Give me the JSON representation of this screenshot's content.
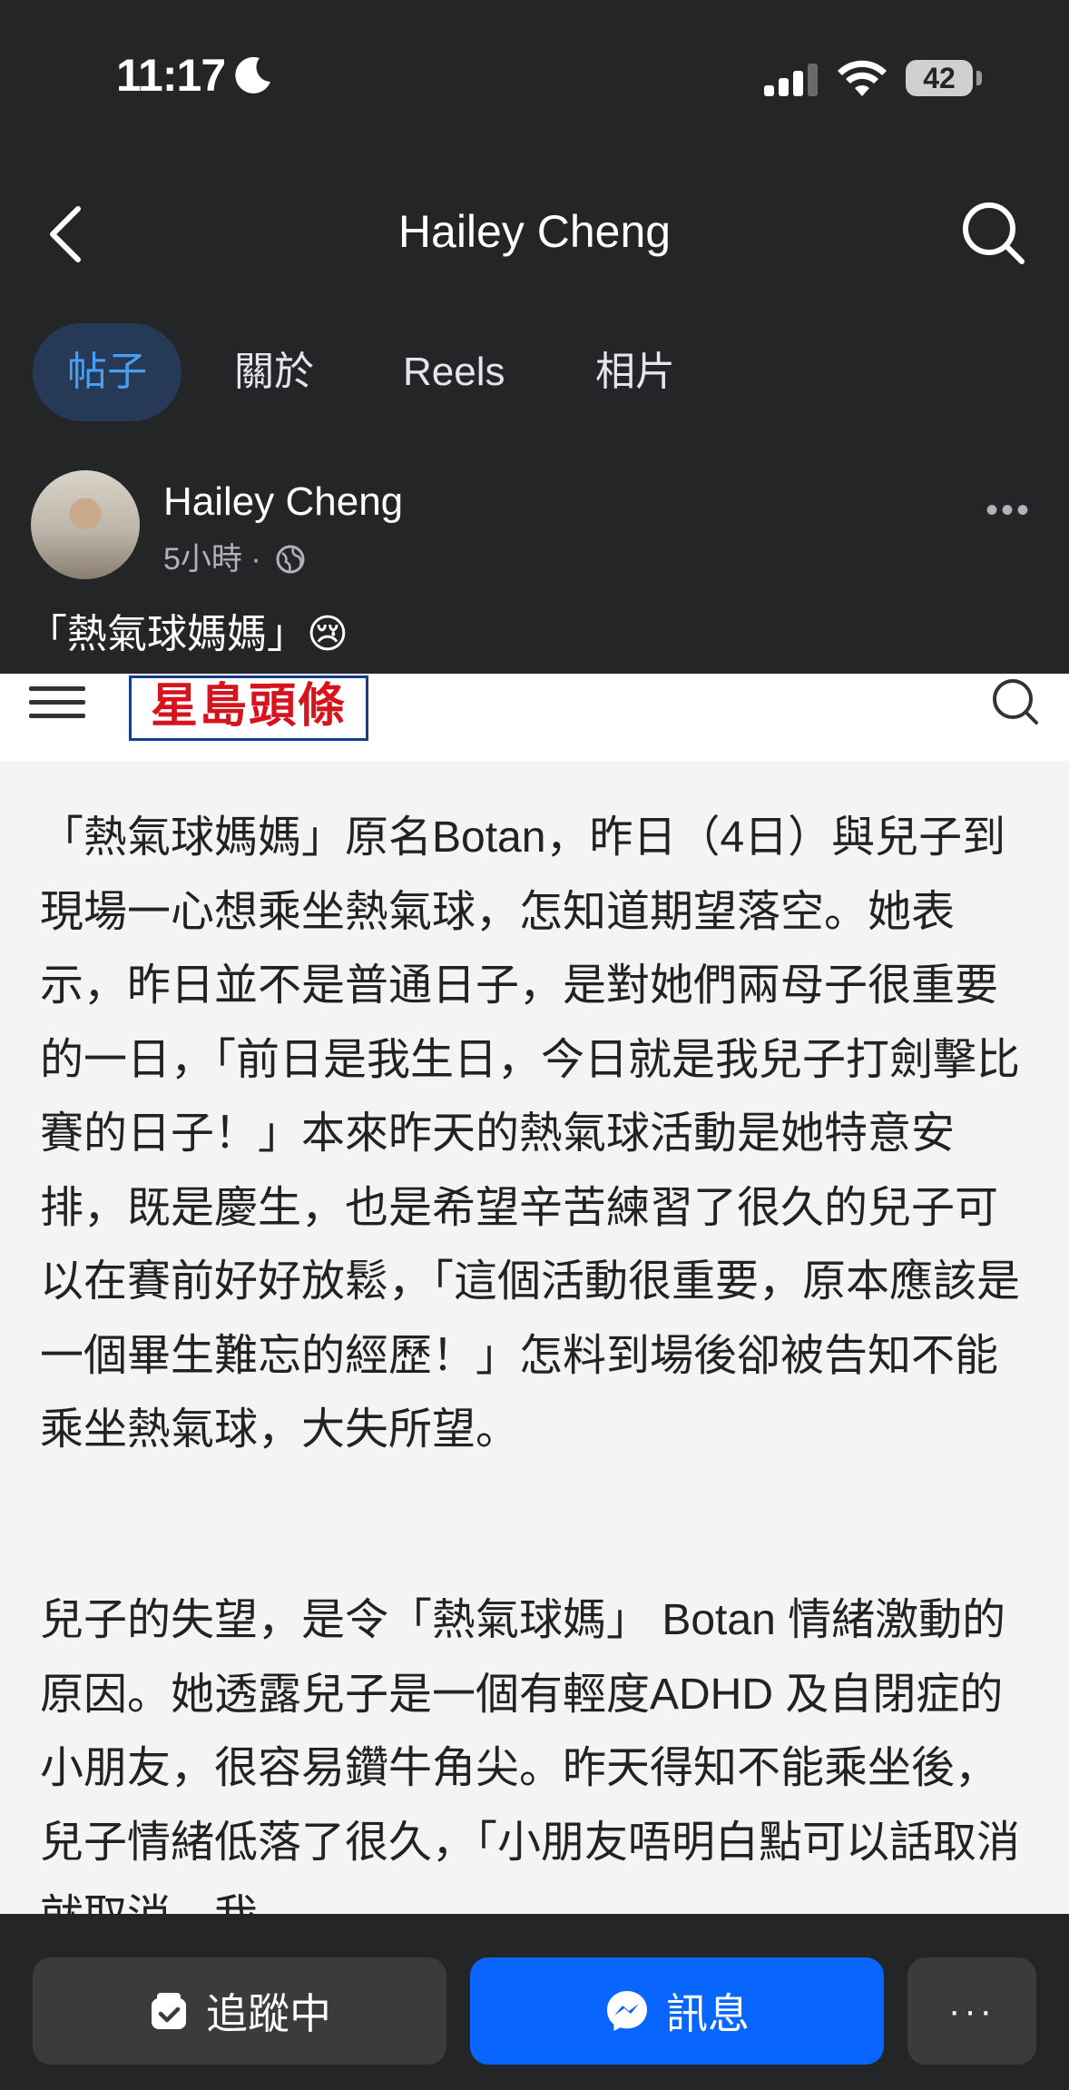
{
  "status_bar": {
    "time": "11:17",
    "battery": "42"
  },
  "nav": {
    "title": "Hailey Cheng"
  },
  "tabs": [
    "帖子",
    "關於",
    "Reels",
    "相片"
  ],
  "post": {
    "author": "Hailey Cheng",
    "meta": "5小時 ·",
    "caption": "「熱氣球媽媽」😢"
  },
  "article": {
    "logo_text": "星島頭條",
    "paragraphs": [
      "「熱氣球媽媽」原名Botan，昨日（4日）與兒子到現場一心想乘坐熱氣球，怎知道期望落空。她表示，昨日並不是普通日子，是對她們兩母子很重要的一日，「前日是我生日，今日就是我兒子打劍擊比賽的日子！」本來昨天的熱氣球活動是她特意安排，既是慶生，也是希望辛苦練習了很久的兒子可以在賽前好好放鬆，「這個活動很重要，原本應該是一個畢生難忘的經歷！」怎料到場後卻被告知不能乘坐熱氣球，大失所望。",
      "兒子的失望，是令「熱氣球媽」 Botan 情緒激動的原因。她透露兒子是一個有輕度ADHD 及自閉症的小朋友，很容易鑽牛角尖。昨天得知不能乘坐後，兒子情緒低落了很久，「小朋友唔明白點可以話取消就取消，我"
    ]
  },
  "bottom_bar": {
    "follow_label": "追蹤中",
    "message_label": "訊息",
    "more_label": "···"
  }
}
